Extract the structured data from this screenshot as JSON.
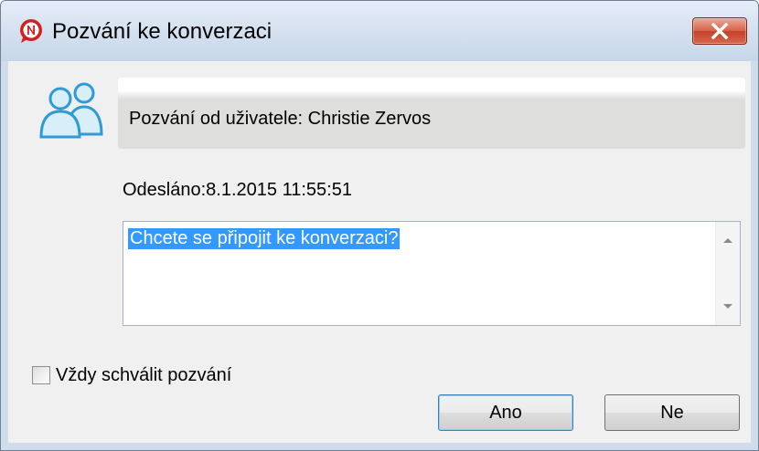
{
  "window": {
    "title": "Pozvání ke konverzaci",
    "icon": "app-logo-icon",
    "close_icon": "close-icon"
  },
  "invite": {
    "from_text": "Pozvání od uživatele: Christie Zervos",
    "icon": "users-icon"
  },
  "sent": {
    "text": "Odesláno:8.1.2015 11:55:51"
  },
  "message": {
    "text": "Chcete se připojit ke konverzaci?"
  },
  "options": {
    "always_approve_label": "Vždy schválit pozvání",
    "always_approve_checked": false
  },
  "buttons": {
    "yes_label": "Ano",
    "no_label": "Ne"
  },
  "colors": {
    "selection": "#3399ff",
    "close_button": "#c4402a",
    "icon_blue": "#2f9ad8",
    "logo_red": "#d21f1f"
  }
}
